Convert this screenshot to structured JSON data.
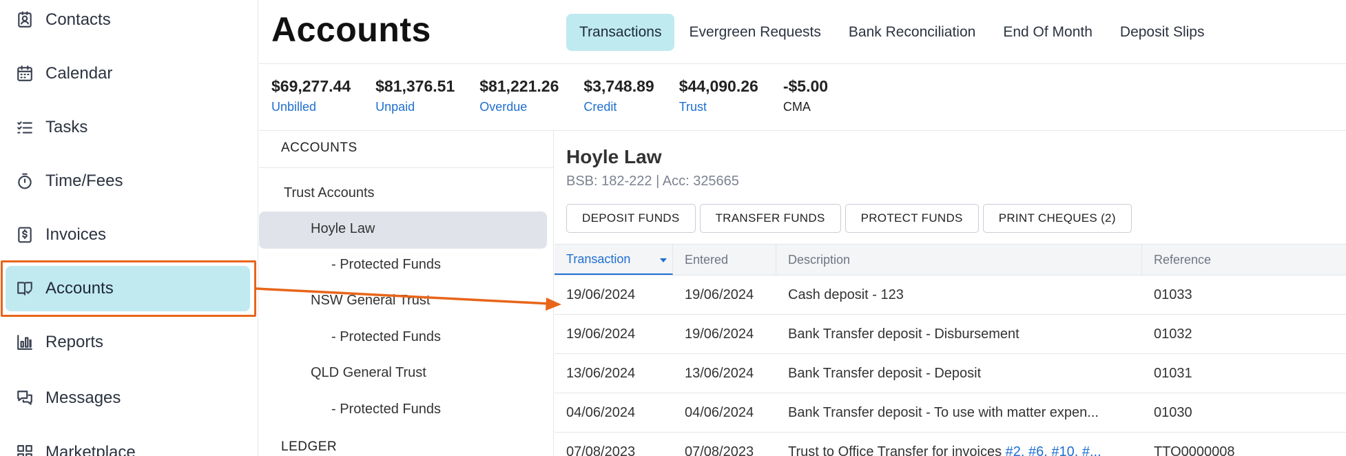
{
  "sidebar": {
    "items": [
      {
        "label": "Contacts",
        "icon": "contacts-icon"
      },
      {
        "label": "Calendar",
        "icon": "calendar-icon"
      },
      {
        "label": "Tasks",
        "icon": "tasks-icon"
      },
      {
        "label": "Time/Fees",
        "icon": "stopwatch-icon"
      },
      {
        "label": "Invoices",
        "icon": "invoice-icon"
      },
      {
        "label": "Accounts",
        "icon": "ledger-book-icon"
      },
      {
        "label": "Reports",
        "icon": "bar-chart-icon"
      },
      {
        "label": "Messages",
        "icon": "chat-bubbles-icon"
      },
      {
        "label": "Marketplace",
        "icon": "apps-grid-icon"
      }
    ],
    "active": "Accounts"
  },
  "header": {
    "title": "Accounts",
    "tabs": [
      {
        "label": "Transactions",
        "active": true
      },
      {
        "label": "Evergreen Requests"
      },
      {
        "label": "Bank Reconciliation"
      },
      {
        "label": "End Of Month"
      },
      {
        "label": "Deposit Slips"
      }
    ]
  },
  "stats": [
    {
      "amount": "$69,277.44",
      "label": "Unbilled"
    },
    {
      "amount": "$81,376.51",
      "label": "Unpaid"
    },
    {
      "amount": "$81,221.26",
      "label": "Overdue"
    },
    {
      "amount": "$3,748.89",
      "label": "Credit"
    },
    {
      "amount": "$44,090.26",
      "label": "Trust"
    },
    {
      "amount": "-$5.00",
      "label": "CMA"
    }
  ],
  "tree": {
    "heading": "ACCOUNTS",
    "group": "Trust Accounts",
    "items": [
      {
        "label": "Hoyle Law",
        "active": true
      },
      {
        "label": "- Protected Funds"
      },
      {
        "label": "NSW General Trust"
      },
      {
        "label": "- Protected Funds"
      },
      {
        "label": "QLD General Trust"
      },
      {
        "label": "- Protected Funds"
      }
    ],
    "ledger_heading": "LEDGER"
  },
  "account": {
    "name": "Hoyle Law",
    "details": "BSB: 182-222 | Acc: 325665",
    "actions": [
      "DEPOSIT FUNDS",
      "TRANSFER FUNDS",
      "PROTECT FUNDS",
      "PRINT CHEQUES (2)"
    ]
  },
  "table": {
    "columns": [
      "Transaction",
      "Entered",
      "Description",
      "Reference"
    ],
    "sorted_column": "Transaction",
    "rows": [
      {
        "transaction": "19/06/2024",
        "entered": "19/06/2024",
        "description": "Cash deposit - 123",
        "reference": "01033"
      },
      {
        "transaction": "19/06/2024",
        "entered": "19/06/2024",
        "description": "Bank Transfer deposit - Disbursement",
        "reference": "01032"
      },
      {
        "transaction": "13/06/2024",
        "entered": "13/06/2024",
        "description": "Bank Transfer deposit - Deposit",
        "reference": "01031"
      },
      {
        "transaction": "04/06/2024",
        "entered": "04/06/2024",
        "description": "Bank Transfer deposit - To use with matter expen...",
        "reference": "01030"
      },
      {
        "transaction": "07/08/2023",
        "entered": "07/08/2023",
        "description_prefix": "Trust to Office Transfer for invoices ",
        "description_links": "#2, #6, #10, #...",
        "reference": "TTO0000008"
      }
    ]
  },
  "colors": {
    "accent_active_bg": "#c0eaf0",
    "link_blue": "#1f6fd1",
    "annotation_orange": "#e8651a"
  }
}
